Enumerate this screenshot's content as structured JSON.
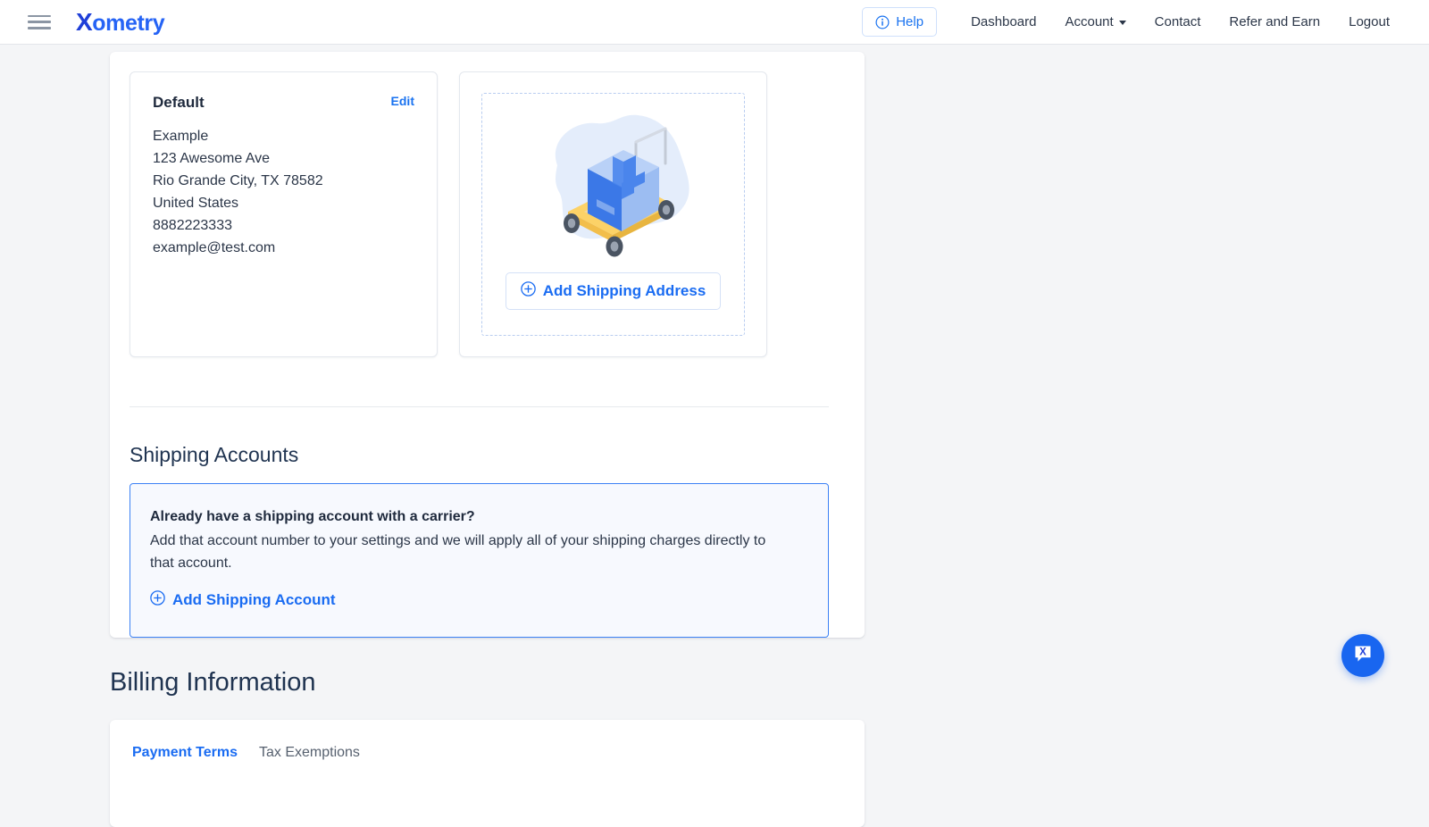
{
  "header": {
    "menu_icon": "hamburger-menu-icon",
    "logo_text": "ometry",
    "logo_initial": "X",
    "help_label": "Help",
    "help_icon": "info-circle-icon",
    "nav": [
      {
        "label": "Dashboard",
        "has_caret": false
      },
      {
        "label": "Account",
        "has_caret": true
      },
      {
        "label": "Contact",
        "has_caret": false
      },
      {
        "label": "Refer and Earn",
        "has_caret": false
      },
      {
        "label": "Logout",
        "has_caret": false
      }
    ]
  },
  "shipping_addresses": {
    "default_card": {
      "title": "Default",
      "edit_label": "Edit",
      "lines": [
        "Example",
        "123 Awesome Ave",
        "Rio Grande City, TX 78582",
        "United States",
        "8882223333",
        "example@test.com"
      ]
    },
    "add_card": {
      "illustration": "shipping-cart-box-illustration",
      "button_label": "Add Shipping Address",
      "button_icon": "plus-circle-icon"
    }
  },
  "shipping_accounts": {
    "section_title": "Shipping Accounts",
    "info_heading": "Already have a shipping account with a carrier?",
    "info_body": "Add that account number to your settings and we will apply all of your shipping charges directly to that account.",
    "add_link_label": "Add Shipping Account",
    "add_link_icon": "plus-circle-icon"
  },
  "billing": {
    "section_title": "Billing Information",
    "tabs": [
      {
        "label": "Payment Terms",
        "active": true
      },
      {
        "label": "Tax Exemptions",
        "active": false
      }
    ]
  },
  "chat": {
    "fab_icon": "chat-bubble-x-icon"
  },
  "colors": {
    "brand_blue": "#1a6cf2",
    "logo_dark_blue": "#1f3fd8",
    "page_background": "#f4f5f7",
    "info_box_border": "#3d82f5",
    "info_box_background": "#f7f9fe",
    "text_dark": "#1f2a3d",
    "heading_navy": "#1f3350",
    "illustration_yellow": "#fbca4f",
    "illustration_box_blue": "#3b78e7",
    "illustration_blob": "#e3ecfb"
  }
}
